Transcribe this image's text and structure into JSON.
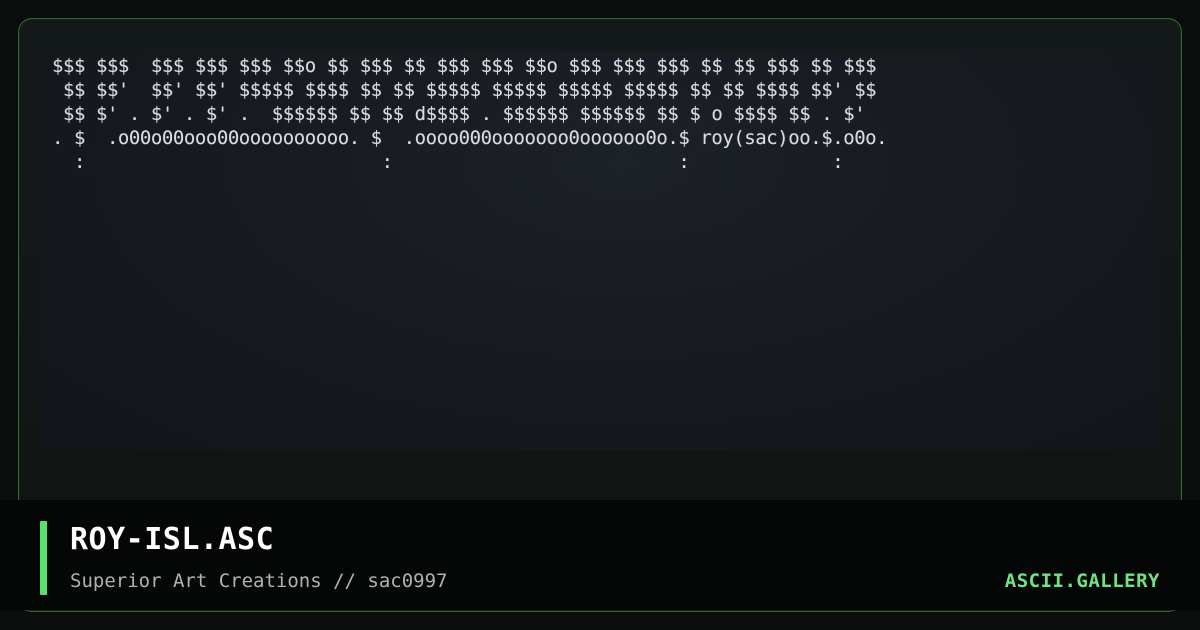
{
  "art": {
    "lines": [
      "$$$ $$$  $$$ $$$ $$$ $$o $$ $$$ $$ $$$ $$$ $$o $$$ $$$ $$$ $$ $$ $$$ $$ $$$",
      " $$ $$'  $$' $$' $$$$$ $$$$ $$ $$ $$$$$ $$$$$ $$$$$ $$$$$ $$ $$ $$$$ $$' $$",
      " $$ $' . $' . $' .  $$$$$$ $$ $$ d$$$$ . $$$$$$ $$$$$$ $$ $ o $$$$ $$ . $'",
      ". $  .o00o00ooo00oooooooooo. $  .oooo000ooooooo0oooooo0o.$ roy(sac)oo.$.o0o.",
      "  :                           :                          :             :"
    ]
  },
  "footer": {
    "title": "ROY-ISL.ASC",
    "subtitle": "Superior Art Creations // sac0997",
    "brand": "ASCII.GALLERY"
  },
  "colors": {
    "accent": "#58e26d",
    "brand": "#6ee67f",
    "border": "#2f6a34",
    "background": "#0a0d0c"
  }
}
